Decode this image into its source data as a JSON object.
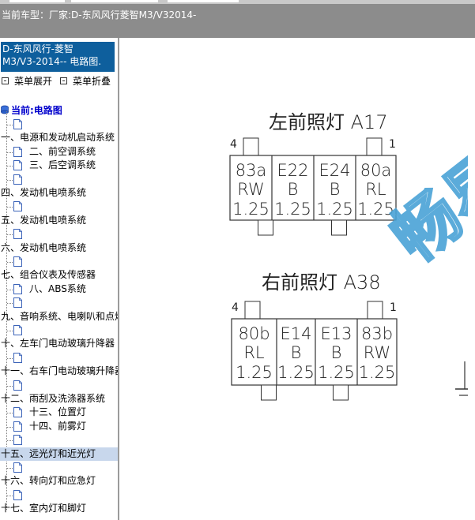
{
  "header": {
    "title_label": "当前车型：",
    "title_value": "厂家:D-东风风行菱智M3/V32014-"
  },
  "sidebar": {
    "title_line1": "D-东风风行-菱智",
    "title_line2": "M3/V3-2014-- 电路图.",
    "expand_label": "菜单展开",
    "collapse_label": "菜单折叠",
    "current_label": "当前:电路图",
    "items": [
      {
        "label": "",
        "indent": 1
      },
      {
        "label": "一、电源和发动机启动系统",
        "indent": 0
      },
      {
        "label": "二、前空调系统",
        "indent": 1
      },
      {
        "label": "三、后空调系统",
        "indent": 1
      },
      {
        "label": "",
        "indent": 1
      },
      {
        "label": "四、发动机电喷系统",
        "indent": 0
      },
      {
        "label": "",
        "indent": 1
      },
      {
        "label": "五、发动机电喷系统",
        "indent": 0
      },
      {
        "label": "",
        "indent": 1
      },
      {
        "label": "六、发动机电喷系统",
        "indent": 0
      },
      {
        "label": "",
        "indent": 1
      },
      {
        "label": "七、组合仪表及传感器",
        "indent": 0
      },
      {
        "label": "八、ABS系统",
        "indent": 1
      },
      {
        "label": "",
        "indent": 1
      },
      {
        "label": "九、音响系统、电喇叭和点烟器",
        "indent": 0
      },
      {
        "label": "",
        "indent": 1
      },
      {
        "label": "十、左车门电动玻璃升降器",
        "indent": 0
      },
      {
        "label": "",
        "indent": 1
      },
      {
        "label": "十一、右车门电动玻璃升降器",
        "indent": 0
      },
      {
        "label": "",
        "indent": 1
      },
      {
        "label": "十二、雨刮及洗涤器系统",
        "indent": 0
      },
      {
        "label": "十三、位置灯",
        "indent": 1
      },
      {
        "label": "十四、前雾灯",
        "indent": 1
      },
      {
        "label": "",
        "indent": 1
      },
      {
        "label": "十五、远光灯和近光灯",
        "indent": 0,
        "highlighted": true
      },
      {
        "label": "",
        "indent": 1
      },
      {
        "label": "十六、转向灯和应急灯",
        "indent": 0
      },
      {
        "label": "",
        "indent": 1
      },
      {
        "label": "十七、室内灯和脚灯",
        "indent": 0
      }
    ]
  },
  "diagram": {
    "watermark": "畅易",
    "connectors": [
      {
        "title": "左前照灯 A17",
        "pin_left": "4",
        "pin_right": "1",
        "cells": [
          {
            "code": "83a",
            "color": "RW",
            "size": "1.25"
          },
          {
            "code": "E22",
            "color": "B",
            "size": "1.25"
          },
          {
            "code": "E24",
            "color": "B",
            "size": "1.25"
          },
          {
            "code": "80a",
            "color": "RL",
            "size": "1.25"
          }
        ]
      },
      {
        "title": "右前照灯 A38",
        "pin_left": "4",
        "pin_right": "1",
        "cells": [
          {
            "code": "80b",
            "color": "RL",
            "size": "1.25"
          },
          {
            "code": "E14",
            "color": "B",
            "size": "1.25"
          },
          {
            "code": "E13",
            "color": "B",
            "size": "1.25"
          },
          {
            "code": "83b",
            "color": "RW",
            "size": "1.25"
          }
        ]
      }
    ]
  },
  "colors": {
    "header_bg": "#8c8c8c",
    "sidebar_title_bg": "#0e5f9d",
    "current_text": "#0000cc",
    "highlight_row": "#c8d7ec",
    "watermark": "#4aa3d6"
  }
}
